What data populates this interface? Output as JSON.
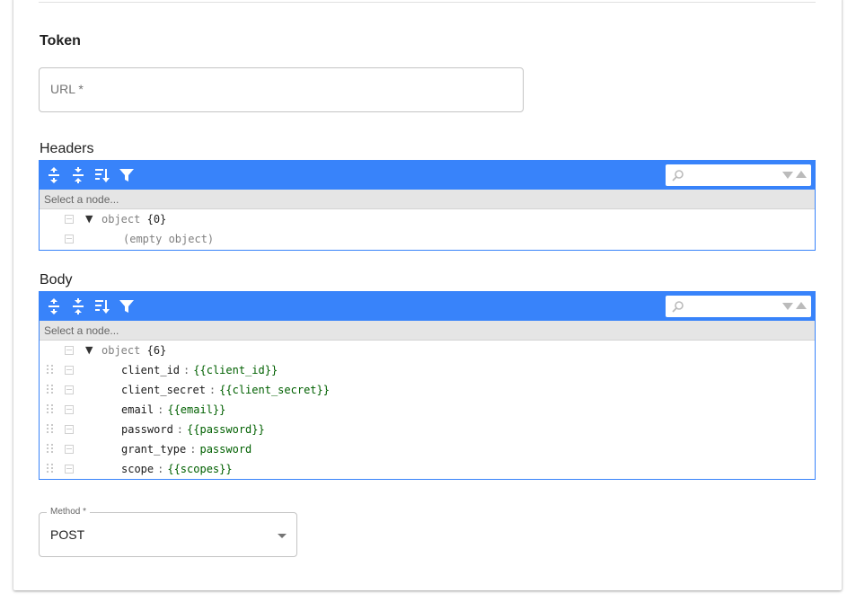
{
  "section": {
    "title": "Token"
  },
  "url_field": {
    "label": "URL *",
    "value": ""
  },
  "headers": {
    "label": "Headers",
    "nav_placeholder": "Select a node...",
    "root": {
      "type": "object",
      "count": "{0}"
    },
    "empty_text": "(empty object)"
  },
  "body": {
    "label": "Body",
    "nav_placeholder": "Select a node...",
    "root": {
      "type": "object",
      "count": "{6}"
    },
    "fields": [
      {
        "key": "client_id",
        "value": "{{client_id}}"
      },
      {
        "key": "client_secret",
        "value": "{{client_secret}}"
      },
      {
        "key": "email",
        "value": "{{email}}"
      },
      {
        "key": "password",
        "value": "{{password}}"
      },
      {
        "key": "grant_type",
        "value": "password"
      },
      {
        "key": "scope",
        "value": "{{scopes}}"
      }
    ]
  },
  "method": {
    "label": "Method *",
    "value": "POST"
  },
  "icons": {
    "expand_all": "expand-all-icon",
    "collapse_all": "collapse-all-icon",
    "sort": "sort-icon",
    "filter": "filter-icon",
    "search": "search-icon"
  },
  "colors": {
    "editor_accent": "#3883fa",
    "value_green": "#006000"
  }
}
